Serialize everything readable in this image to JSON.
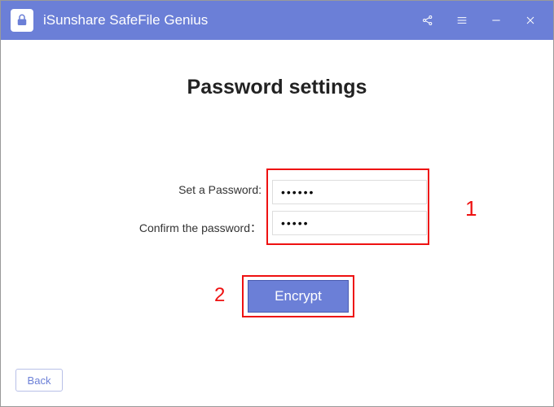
{
  "app": {
    "title": "iSunshare SafeFile Genius"
  },
  "page": {
    "heading": "Password settings",
    "set_label": "Set a Password:",
    "confirm_label": "Confirm the password：",
    "set_value": "••••••",
    "confirm_value": "•••••",
    "encrypt_label": "Encrypt",
    "back_label": "Back"
  },
  "annotations": {
    "field_group": "1",
    "button": "2"
  },
  "colors": {
    "accent": "#6b7fd7",
    "highlight": "#e11"
  }
}
